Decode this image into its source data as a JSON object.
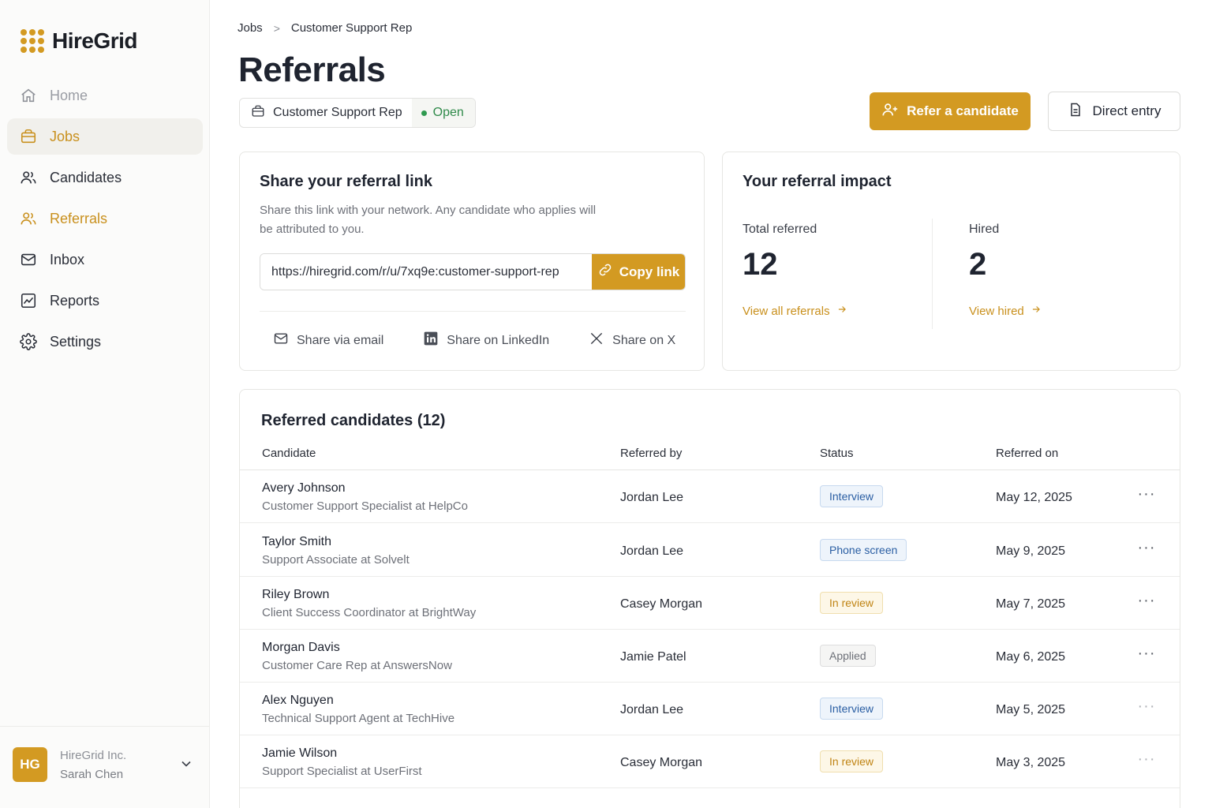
{
  "app": {
    "name": "HireGrid",
    "brand_color": "#d39a22"
  },
  "sidebar": {
    "items": [
      {
        "label": "Home",
        "icon": "home-icon",
        "state": "muted"
      },
      {
        "label": "Jobs",
        "icon": "briefcase-icon",
        "state": "active"
      },
      {
        "label": "Candidates",
        "icon": "users-icon",
        "state": "normal"
      },
      {
        "label": "Referrals",
        "icon": "users-icon",
        "state": "highlight"
      },
      {
        "label": "Inbox",
        "icon": "mail-icon",
        "state": "normal"
      },
      {
        "label": "Reports",
        "icon": "chart-icon",
        "state": "normal"
      },
      {
        "label": "Settings",
        "icon": "gear-icon",
        "state": "normal"
      }
    ],
    "footer": {
      "avatar": "HG",
      "org": "HireGrid Inc.",
      "user": "Sarah Chen"
    }
  },
  "breadcrumb": {
    "parent": "Jobs",
    "separator": ">",
    "current": "Customer Support Rep"
  },
  "page": {
    "title": "Referrals",
    "job_chip": {
      "job": "Customer Support Rep",
      "status": "Open"
    },
    "actions": {
      "primary": "Refer a candidate",
      "secondary": "Direct entry"
    }
  },
  "share": {
    "title": "Share your referral link",
    "description": "Share this link with your network. Any candidate who applies will be attributed to you.",
    "link": "https://hiregrid.com/r/u/7xq9e:customer-support-rep",
    "copy_label": "Copy link",
    "email": "Share via email",
    "linkedin": "Share on LinkedIn",
    "x": "Share on X"
  },
  "impact": {
    "title": "Your referral impact",
    "total_label": "Total referred",
    "total_value": "12",
    "total_link": "View all referrals",
    "hired_label": "Hired",
    "hired_value": "2",
    "hired_link": "View hired"
  },
  "table": {
    "title": "Referred candidates (12)",
    "columns": [
      "Candidate",
      "Referred by",
      "Status",
      "Referred on"
    ],
    "rows": [
      {
        "name": "Avery Johnson",
        "role": "Customer Support Specialist at HelpCo",
        "referred_by": "Jordan Lee",
        "status": "Interview",
        "status_kind": "interview",
        "date": "May 12, 2025",
        "menu": "···"
      },
      {
        "name": "Taylor Smith",
        "role": "Support Associate at Solvelt",
        "referred_by": "Jordan Lee",
        "status": "Phone screen",
        "status_kind": "phone",
        "date": "May 9, 2025",
        "menu": "···"
      },
      {
        "name": "Riley Brown",
        "role": "Client Success Coordinator at BrightWay",
        "referred_by": "Casey Morgan",
        "status": "In review",
        "status_kind": "review",
        "date": "May 7, 2025",
        "menu": "···"
      },
      {
        "name": "Morgan Davis",
        "role": "Customer Care Rep at AnswersNow",
        "referred_by": "Jamie Patel",
        "status": "Applied",
        "status_kind": "applied",
        "date": "May 6, 2025",
        "menu": "···"
      },
      {
        "name": "Alex Nguyen",
        "role": "Technical Support Agent at TechHive",
        "referred_by": "Jordan Lee",
        "status": "Interview",
        "status_kind": "interview",
        "date": "May 5, 2025",
        "menu": "···"
      },
      {
        "name": "Jamie Wilson",
        "role": "Support Specialist at UserFirst",
        "referred_by": "Casey Morgan",
        "status": "In review",
        "status_kind": "review",
        "date": "May 3, 2025",
        "menu": "···"
      }
    ]
  }
}
